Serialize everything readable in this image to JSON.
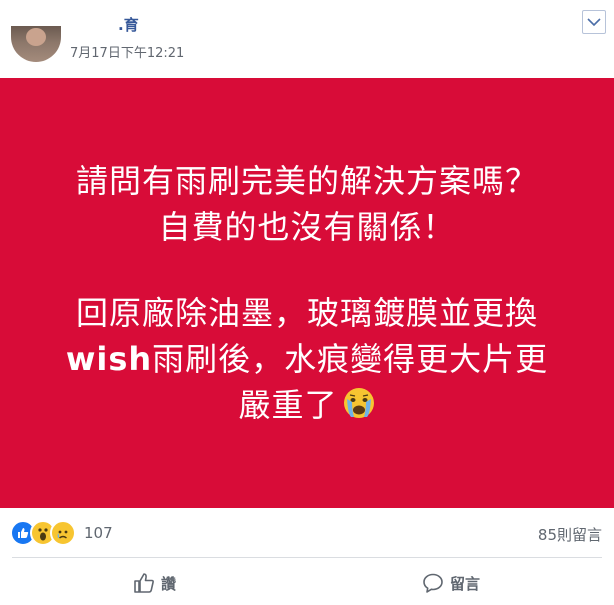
{
  "post": {
    "author_name": ".育",
    "timestamp": "7月17日下午12:21",
    "content": {
      "line1": "請問有雨刷完美的解決方案嗎？",
      "line2": "自費的也沒有關係！",
      "line3": "回原廠除油墨，玻璃鍍膜並更換",
      "line4_en": "wish",
      "line4_rest": "雨刷後，水痕變得更大片更",
      "line5": "嚴重了"
    },
    "background_color": "#d80c38"
  },
  "reactions": {
    "icons": [
      "like-icon",
      "wow-icon",
      "sad-icon"
    ],
    "count": "107",
    "comments_label": "85則留言"
  },
  "actions": {
    "like_label": "讚",
    "comment_label": "留言"
  }
}
